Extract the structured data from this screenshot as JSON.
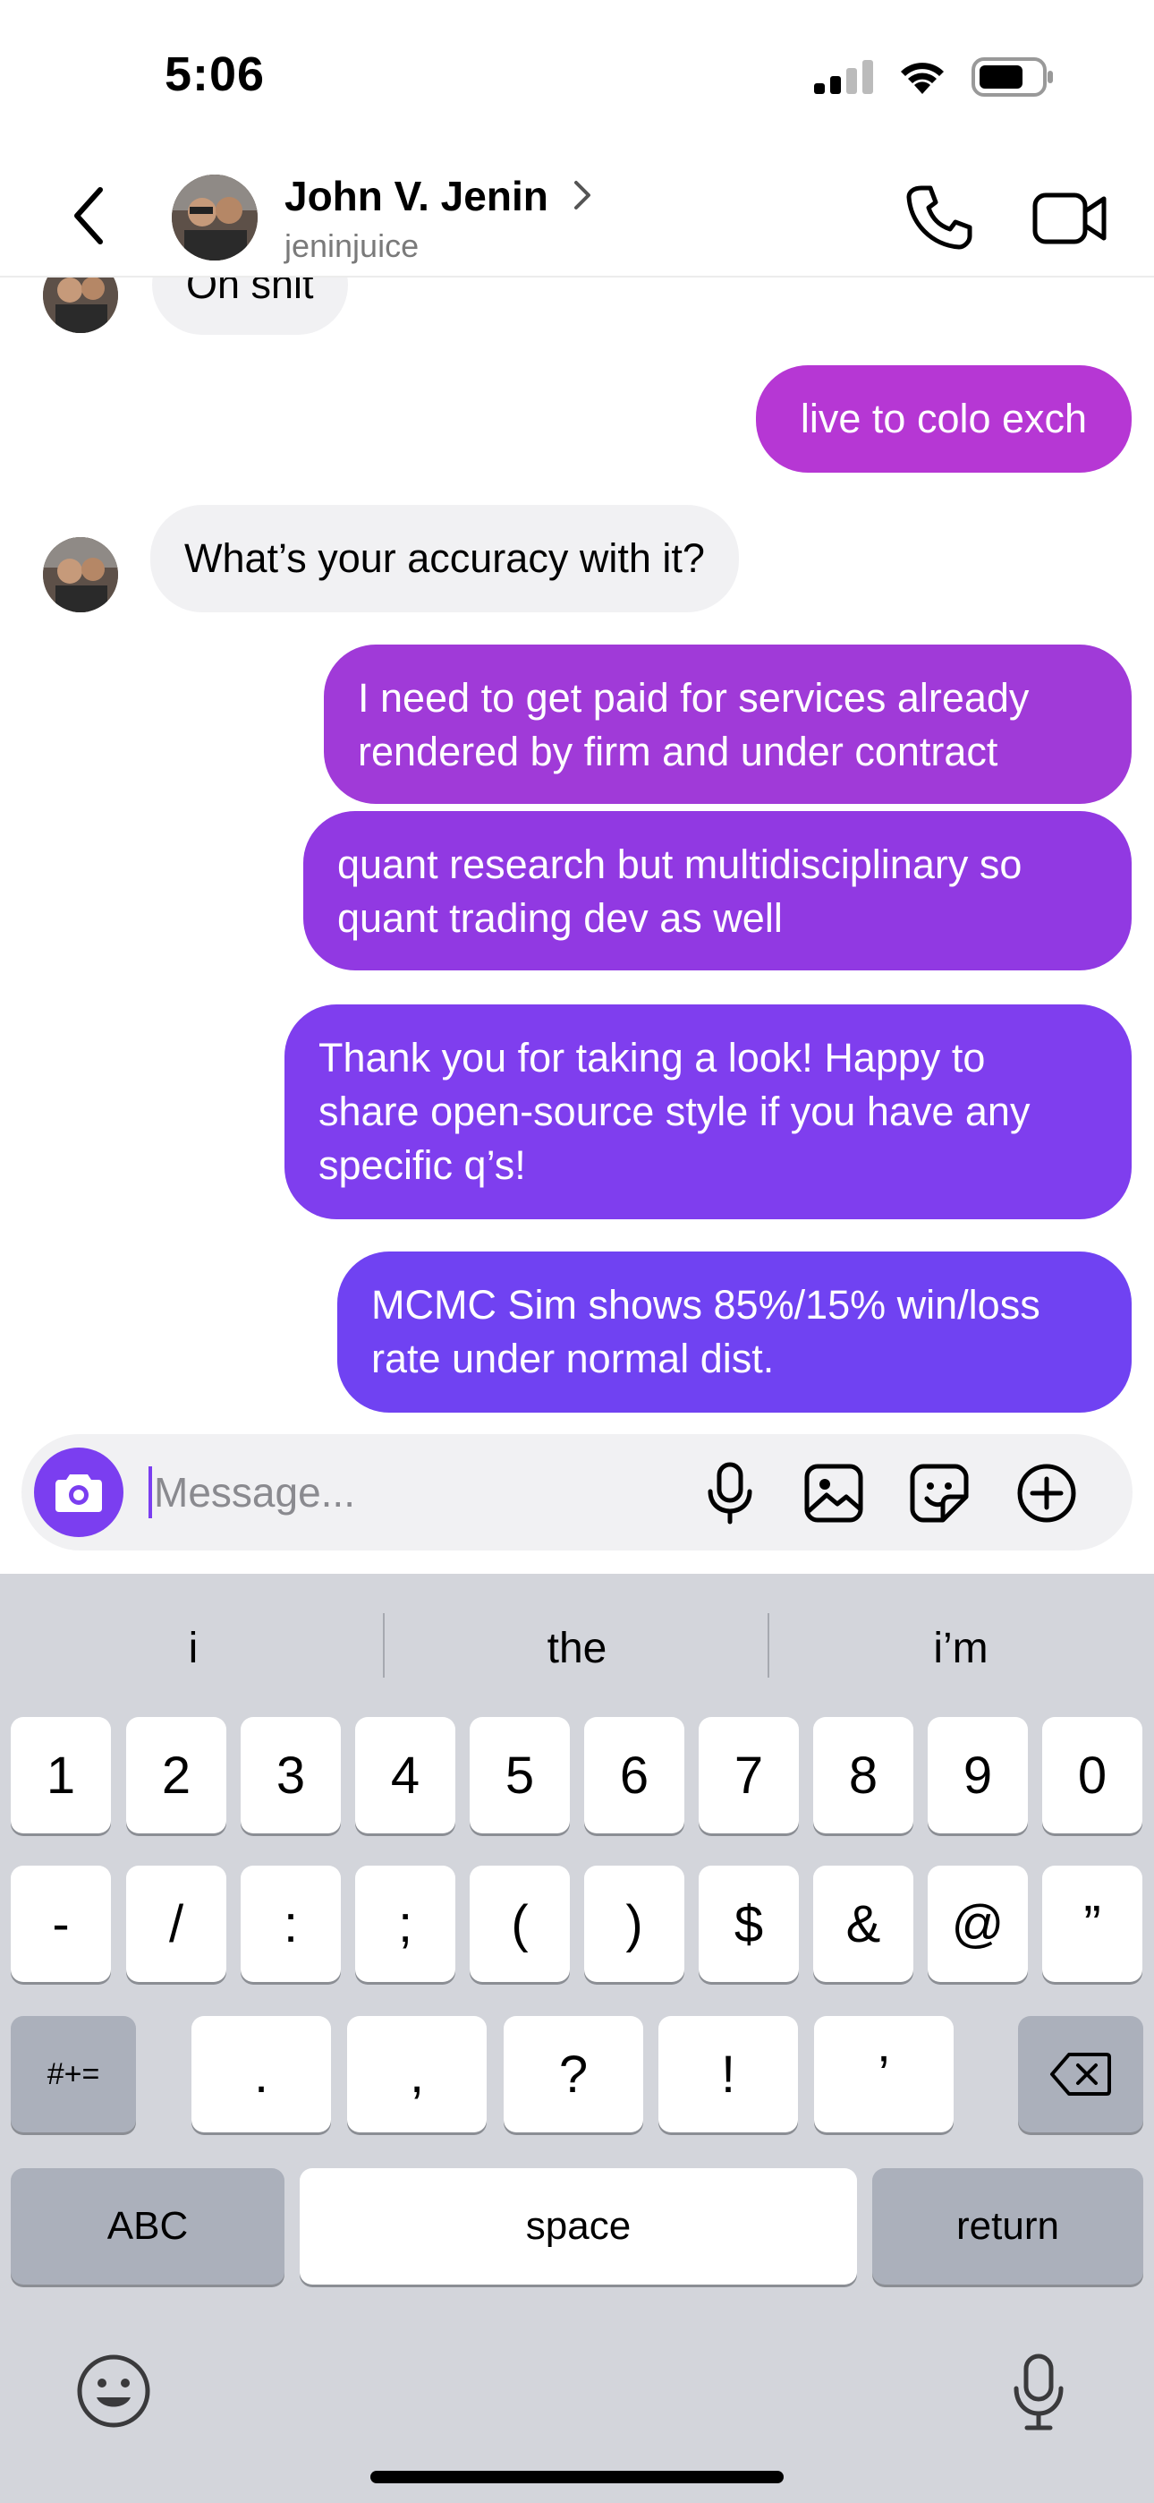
{
  "status": {
    "time": "5:06"
  },
  "header": {
    "name": "John V. Jenin",
    "handle": "jeninjuice",
    "back_icon": "chevron-left-icon",
    "call_icon": "phone-icon",
    "video_icon": "video-icon"
  },
  "messages": [
    {
      "side": "in",
      "text": "Oh shit"
    },
    {
      "side": "out",
      "text": "live to colo exch"
    },
    {
      "side": "in",
      "text": "What’s your accuracy with it?"
    },
    {
      "side": "out",
      "line1": "I need to get paid for services already",
      "line2": "rendered by firm and under contract"
    },
    {
      "side": "out",
      "line1": "quant research but multidisciplinary so",
      "line2": "quant trading dev as well"
    },
    {
      "side": "out",
      "line1": "Thank you for taking a look! Happy to",
      "line2": "share open-source style if you have any",
      "line3": "specific q’s!"
    },
    {
      "side": "out",
      "line1": "MCMC Sim shows 85%/15% win/loss",
      "line2": "rate under normal dist."
    }
  ],
  "composer": {
    "placeholder": "Message..."
  },
  "keyboard": {
    "suggestions": [
      "i",
      "the",
      "i’m"
    ],
    "row1": [
      "1",
      "2",
      "3",
      "4",
      "5",
      "6",
      "7",
      "8",
      "9",
      "0"
    ],
    "row2": [
      "-",
      "/",
      ":",
      ";",
      "(",
      ")",
      "$",
      "&",
      "@",
      "”"
    ],
    "row3_left": "#+=",
    "row3": [
      ".",
      ",",
      "?",
      "!",
      "’"
    ],
    "abc": "ABC",
    "space": "space",
    "return": "return"
  },
  "colors": {
    "accent": "#7b3ef0",
    "bubble_top": "#b637d4",
    "bubble_bottom": "#7042f2",
    "incoming": "#f1f1f3"
  }
}
